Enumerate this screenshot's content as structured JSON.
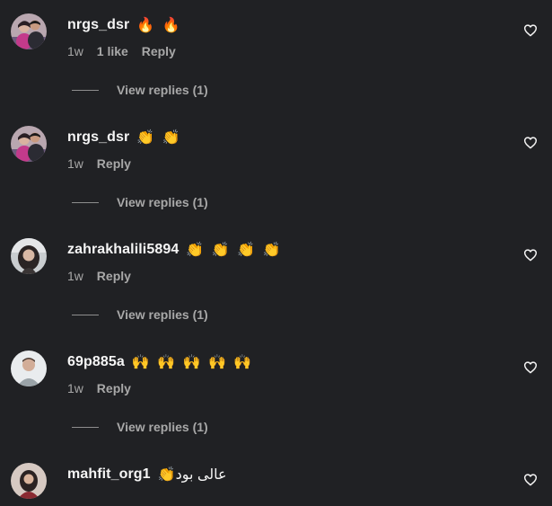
{
  "comments": [
    {
      "username": "nrgs_dsr",
      "text": "🔥 🔥",
      "time": "1w",
      "likes": "1 like",
      "reply_label": "Reply",
      "view_replies": "View replies (1)",
      "avatar_icon": "couple-photo-avatar"
    },
    {
      "username": "nrgs_dsr",
      "text": "👏 👏",
      "time": "1w",
      "likes": "",
      "reply_label": "Reply",
      "view_replies": "View replies (1)",
      "avatar_icon": "couple-photo-avatar"
    },
    {
      "username": "zahrakhalili5894",
      "text": "👏 👏 👏 👏",
      "time": "1w",
      "likes": "",
      "reply_label": "Reply",
      "view_replies": "View replies (1)",
      "avatar_icon": "woman-photo-avatar"
    },
    {
      "username": "69p885a",
      "text": "🙌 🙌 🙌 🙌 🙌",
      "time": "1w",
      "likes": "",
      "reply_label": "Reply",
      "view_replies": "View replies (1)",
      "avatar_icon": "man-photo-avatar"
    },
    {
      "username": "mahfit_org1",
      "text": "👏عالی بود",
      "time": "",
      "likes": "",
      "reply_label": "",
      "view_replies": "",
      "avatar_icon": "woman-photo-avatar"
    }
  ],
  "icons": {
    "like": "heart-outline-icon"
  },
  "colors": {
    "background": "#202124",
    "primary_text": "#f5f5f5",
    "secondary_text": "#a8a8a8"
  }
}
